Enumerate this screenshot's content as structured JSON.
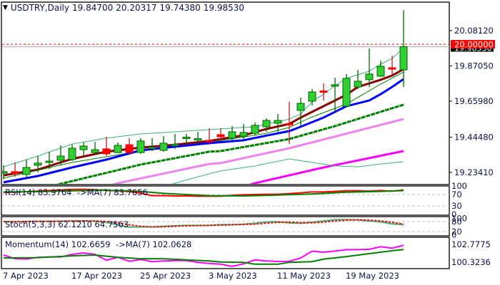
{
  "header": {
    "icon": "triangle-down-icon",
    "symbol": "USDTRY,Daily",
    "open": "19.84700",
    "high": "20.20317",
    "low": "19.74380",
    "close": "19.98530"
  },
  "indicators": {
    "rsi_label": "RSI(14) 85.9764  ->MA(7) 83.7656",
    "stoch_label": "Stoch(5,3,3) 62.1210 64.7563",
    "momentum_label": "Momentum(14) 102.6659  ->MA(7) 102.0628"
  },
  "colors": {
    "bull": "#32cd32",
    "bear": "#ff0000",
    "wick_bull": "#006400",
    "wick_bear": "#b22222",
    "ma_darkred": "#8b0000",
    "ma_green": "#008000",
    "ma_blue": "#0000ff",
    "band": "#3cb371",
    "ma_pink": "#ee82ee",
    "ma_magenta": "#ff00ff",
    "level_line": "#ff0000",
    "bid_line": "#c0c0c0"
  },
  "chart_data": [
    {
      "type": "candlestick",
      "title": "USDTRY,Daily",
      "ylim": [
        19.166,
        20.239
      ],
      "yticks": [
        "20.08120",
        "19.87050",
        "19.65980",
        "19.44480",
        "19.23410"
      ],
      "xticks": [
        {
          "bar": 0,
          "label": "7 Apr 2023"
        },
        {
          "bar": 6,
          "label": "17 Apr 2023"
        },
        {
          "bar": 12,
          "label": "25 Apr 2023"
        },
        {
          "bar": 18,
          "label": "3 May 2023"
        },
        {
          "bar": 24,
          "label": "11 May 2023"
        },
        {
          "bar": 30,
          "label": "19 May 2023"
        }
      ],
      "price_level": {
        "value": 20.0,
        "label": "20.00000"
      },
      "bid": {
        "value": 19.9853,
        "label": "19.98530"
      },
      "ohlc": [
        [
          19.23,
          19.277,
          19.192,
          19.239
        ],
        [
          19.239,
          19.294,
          19.209,
          19.226
        ],
        [
          19.222,
          19.311,
          19.2,
          19.264
        ],
        [
          19.277,
          19.332,
          19.234,
          19.29
        ],
        [
          19.294,
          19.358,
          19.256,
          19.302
        ],
        [
          19.307,
          19.396,
          19.277,
          19.332
        ],
        [
          19.311,
          19.4,
          19.302,
          19.379
        ],
        [
          19.37,
          19.413,
          19.336,
          19.392
        ],
        [
          19.353,
          19.417,
          19.341,
          19.37
        ],
        [
          19.375,
          19.447,
          19.332,
          19.345
        ],
        [
          19.353,
          19.413,
          19.349,
          19.396
        ],
        [
          19.4,
          19.439,
          19.345,
          19.353
        ],
        [
          19.353,
          19.439,
          19.345,
          19.422
        ],
        [
          19.383,
          19.439,
          19.362,
          19.385
        ],
        [
          19.366,
          19.451,
          19.358,
          19.409
        ],
        [
          19.4,
          19.464,
          19.375,
          19.402
        ],
        [
          19.443,
          19.464,
          19.4,
          19.445
        ],
        [
          19.434,
          19.477,
          19.404,
          19.436
        ],
        [
          19.426,
          19.498,
          19.4,
          19.422
        ],
        [
          19.46,
          19.498,
          19.43,
          19.447
        ],
        [
          19.439,
          19.511,
          19.426,
          19.477
        ],
        [
          19.451,
          19.524,
          19.434,
          19.473
        ],
        [
          19.468,
          19.532,
          19.456,
          19.515
        ],
        [
          19.507,
          19.558,
          19.477,
          19.545
        ],
        [
          19.528,
          19.583,
          19.477,
          19.545
        ],
        [
          19.526,
          19.656,
          19.404,
          19.522
        ],
        [
          19.605,
          19.681,
          19.507,
          19.647
        ],
        [
          19.66,
          19.732,
          19.634,
          19.715
        ],
        [
          19.721,
          19.766,
          19.664,
          19.717
        ],
        [
          19.756,
          19.8,
          19.592,
          19.758
        ],
        [
          19.63,
          19.822,
          19.63,
          19.796
        ],
        [
          19.745,
          19.847,
          19.732,
          19.779
        ],
        [
          19.788,
          19.975,
          19.745,
          19.822
        ],
        [
          19.809,
          19.902,
          19.805,
          19.868
        ],
        [
          19.86,
          19.932,
          19.809,
          19.851
        ],
        [
          19.847,
          20.20317,
          19.7438,
          19.9853
        ]
      ],
      "series": [
        {
          "name": "upper-band",
          "color": "band",
          "width": 1,
          "points": [
            [
              0,
              19.268
            ],
            [
              3,
              19.332
            ],
            [
              6,
              19.404
            ],
            [
              9,
              19.439
            ],
            [
              12,
              19.464
            ],
            [
              18,
              19.49
            ],
            [
              22,
              19.507
            ],
            [
              25,
              19.553
            ],
            [
              26,
              19.583
            ],
            [
              27,
              19.656
            ],
            [
              28,
              19.702
            ],
            [
              29,
              19.753
            ],
            [
              30,
              19.796
            ],
            [
              32,
              19.839
            ],
            [
              33,
              19.881
            ],
            [
              34,
              19.915
            ],
            [
              35,
              19.979
            ]
          ]
        },
        {
          "name": "ma-darkred",
          "color": "ma_darkred",
          "width": 3,
          "points": [
            [
              0,
              19.217
            ],
            [
              3,
              19.251
            ],
            [
              6,
              19.315
            ],
            [
              9,
              19.358
            ],
            [
              12,
              19.383
            ],
            [
              15,
              19.4
            ],
            [
              18,
              19.422
            ],
            [
              21,
              19.456
            ],
            [
              23,
              19.494
            ],
            [
              25,
              19.524
            ],
            [
              26,
              19.562
            ],
            [
              27,
              19.596
            ],
            [
              28,
              19.63
            ],
            [
              29,
              19.664
            ],
            [
              30,
              19.698
            ],
            [
              31,
              19.745
            ],
            [
              32,
              19.766
            ],
            [
              33,
              19.788
            ],
            [
              34,
              19.813
            ],
            [
              35,
              19.851
            ]
          ]
        },
        {
          "name": "ma-green-thin",
          "color": "ma_green",
          "width": 1,
          "points": [
            [
              0,
              19.2
            ],
            [
              6,
              19.294
            ],
            [
              12,
              19.362
            ],
            [
              18,
              19.413
            ],
            [
              23,
              19.468
            ],
            [
              25,
              19.503
            ],
            [
              27,
              19.566
            ],
            [
              30,
              19.643
            ],
            [
              33,
              19.762
            ],
            [
              35,
              19.834
            ]
          ]
        },
        {
          "name": "ma-blue",
          "color": "ma_blue",
          "width": 3,
          "points": [
            [
              0,
              19.175
            ],
            [
              3,
              19.213
            ],
            [
              6,
              19.264
            ],
            [
              9,
              19.311
            ],
            [
              12,
              19.366
            ],
            [
              15,
              19.388
            ],
            [
              18,
              19.409
            ],
            [
              21,
              19.426
            ],
            [
              24,
              19.468
            ],
            [
              25,
              19.481
            ],
            [
              26,
              19.507
            ],
            [
              28,
              19.562
            ],
            [
              30,
              19.63
            ],
            [
              32,
              19.664
            ],
            [
              33,
              19.702
            ],
            [
              34,
              19.745
            ],
            [
              35,
              19.792
            ]
          ]
        },
        {
          "name": "ma-green-thick",
          "color": "ma_green",
          "width": 3,
          "dash": true,
          "points": [
            [
              4,
              19.149
            ],
            [
              5,
              19.166
            ],
            [
              12,
              19.281
            ],
            [
              18,
              19.358
            ],
            [
              19,
              19.362
            ],
            [
              25,
              19.434
            ],
            [
              29,
              19.511
            ],
            [
              32,
              19.575
            ],
            [
              35,
              19.639
            ]
          ]
        },
        {
          "name": "ma-pink",
          "color": "ma_pink",
          "width": 3,
          "points": [
            [
              9,
              19.149
            ],
            [
              10,
              19.17
            ],
            [
              18,
              19.285
            ],
            [
              19,
              19.29
            ],
            [
              25,
              19.379
            ],
            [
              35,
              19.553
            ]
          ]
        },
        {
          "name": "ma-magenta",
          "color": "ma_magenta",
          "width": 3,
          "points": [
            [
              21,
              19.149
            ],
            [
              22,
              19.17
            ],
            [
              28,
              19.264
            ],
            [
              35,
              19.362
            ]
          ]
        },
        {
          "name": "lower-band",
          "color": "band",
          "width": 1,
          "points": [
            [
              14,
              19.149
            ],
            [
              15,
              19.17
            ],
            [
              18,
              19.226
            ],
            [
              19,
              19.243
            ],
            [
              22,
              19.273
            ],
            [
              25,
              19.315
            ],
            [
              27,
              19.294
            ],
            [
              29,
              19.273
            ],
            [
              31,
              19.268
            ],
            [
              33,
              19.285
            ],
            [
              35,
              19.298
            ]
          ]
        }
      ]
    },
    {
      "type": "line",
      "title": "RSI(14)",
      "ylim": [
        0,
        100
      ],
      "levels": [
        70,
        30
      ],
      "yticks": [
        "100",
        "70",
        "30",
        "0"
      ],
      "series": [
        {
          "name": "RSI",
          "color": "bear",
          "values": [
            77,
            78,
            80,
            82,
            84,
            86,
            88,
            88,
            87,
            84,
            83,
            80,
            75,
            66,
            66,
            65,
            65,
            64,
            64,
            64,
            67,
            69,
            70,
            71,
            71,
            73,
            76,
            79,
            79,
            81,
            83,
            83,
            82,
            84,
            82,
            85.9764
          ]
        },
        {
          "name": "MA(7)",
          "color": "ma_green",
          "points": [
            [
              0,
              79
            ],
            [
              3,
              80
            ],
            [
              6,
              83
            ],
            [
              9,
              85
            ],
            [
              12,
              81
            ],
            [
              14,
              74
            ],
            [
              16,
              70
            ],
            [
              18,
              66
            ],
            [
              21,
              65
            ],
            [
              24,
              68
            ],
            [
              27,
              72
            ],
            [
              30,
              78
            ],
            [
              33,
              81
            ],
            [
              35,
              83.7656
            ]
          ]
        }
      ]
    },
    {
      "type": "line",
      "title": "Stoch(5,3,3)",
      "ylim": [
        0,
        100
      ],
      "levels": [
        80,
        20
      ],
      "yticks": [
        "100",
        "80",
        "20",
        "0"
      ],
      "series": [
        {
          "name": "Main",
          "color": "band",
          "values": [
            80,
            80,
            81,
            82,
            82,
            83,
            84,
            85,
            83,
            75,
            60,
            47,
            48,
            48,
            52,
            55,
            57,
            57,
            58,
            62,
            62,
            64,
            70,
            78,
            80,
            72,
            70,
            76,
            84,
            92,
            92,
            90,
            84,
            78,
            66,
            62.121
          ]
        },
        {
          "name": "Signal",
          "color": "bear",
          "dash": true,
          "values": [
            80,
            80,
            80,
            81,
            82,
            82,
            83,
            84,
            84,
            81,
            73,
            61,
            52,
            48,
            49,
            52,
            55,
            56,
            57,
            59,
            61,
            63,
            65,
            71,
            76,
            77,
            74,
            73,
            77,
            84,
            89,
            91,
            89,
            84,
            76,
            64.7563
          ]
        }
      ]
    },
    {
      "type": "line",
      "title": "Momentum(14)",
      "yticks": [
        "102.7775",
        "100.3236"
      ],
      "series": [
        {
          "name": "Momentum",
          "color": "ma_magenta",
          "values": [
            101.3,
            100.8,
            100.75,
            101.0,
            101.05,
            101.05,
            101.4,
            101.6,
            101.4,
            100.6,
            101.0,
            100.45,
            100.7,
            100.4,
            100.5,
            100.55,
            100.55,
            100.3,
            100.15,
            100.05,
            99.75,
            100.1,
            100.65,
            100.5,
            100.42,
            100.45,
            100.9,
            101.85,
            101.7,
            101.85,
            102.05,
            102.05,
            102.1,
            102.45,
            102.25,
            102.6659
          ]
        },
        {
          "name": "MA(7)",
          "color": "ma_green",
          "points": [
            [
              0,
              100.9
            ],
            [
              3,
              100.95
            ],
            [
              6,
              101.2
            ],
            [
              8,
              101.3
            ],
            [
              10,
              101.0
            ],
            [
              12,
              100.8
            ],
            [
              14,
              100.8
            ],
            [
              16,
              100.65
            ],
            [
              18,
              100.5
            ],
            [
              19,
              100.35
            ],
            [
              21,
              100.3
            ],
            [
              22,
              100.05
            ],
            [
              24,
              100.05
            ],
            [
              25,
              100.3
            ],
            [
              27,
              100.4
            ],
            [
              28,
              100.75
            ],
            [
              30,
              101.1
            ],
            [
              32,
              101.5
            ],
            [
              34,
              101.9
            ],
            [
              35,
              102.0628
            ]
          ]
        }
      ]
    }
  ]
}
